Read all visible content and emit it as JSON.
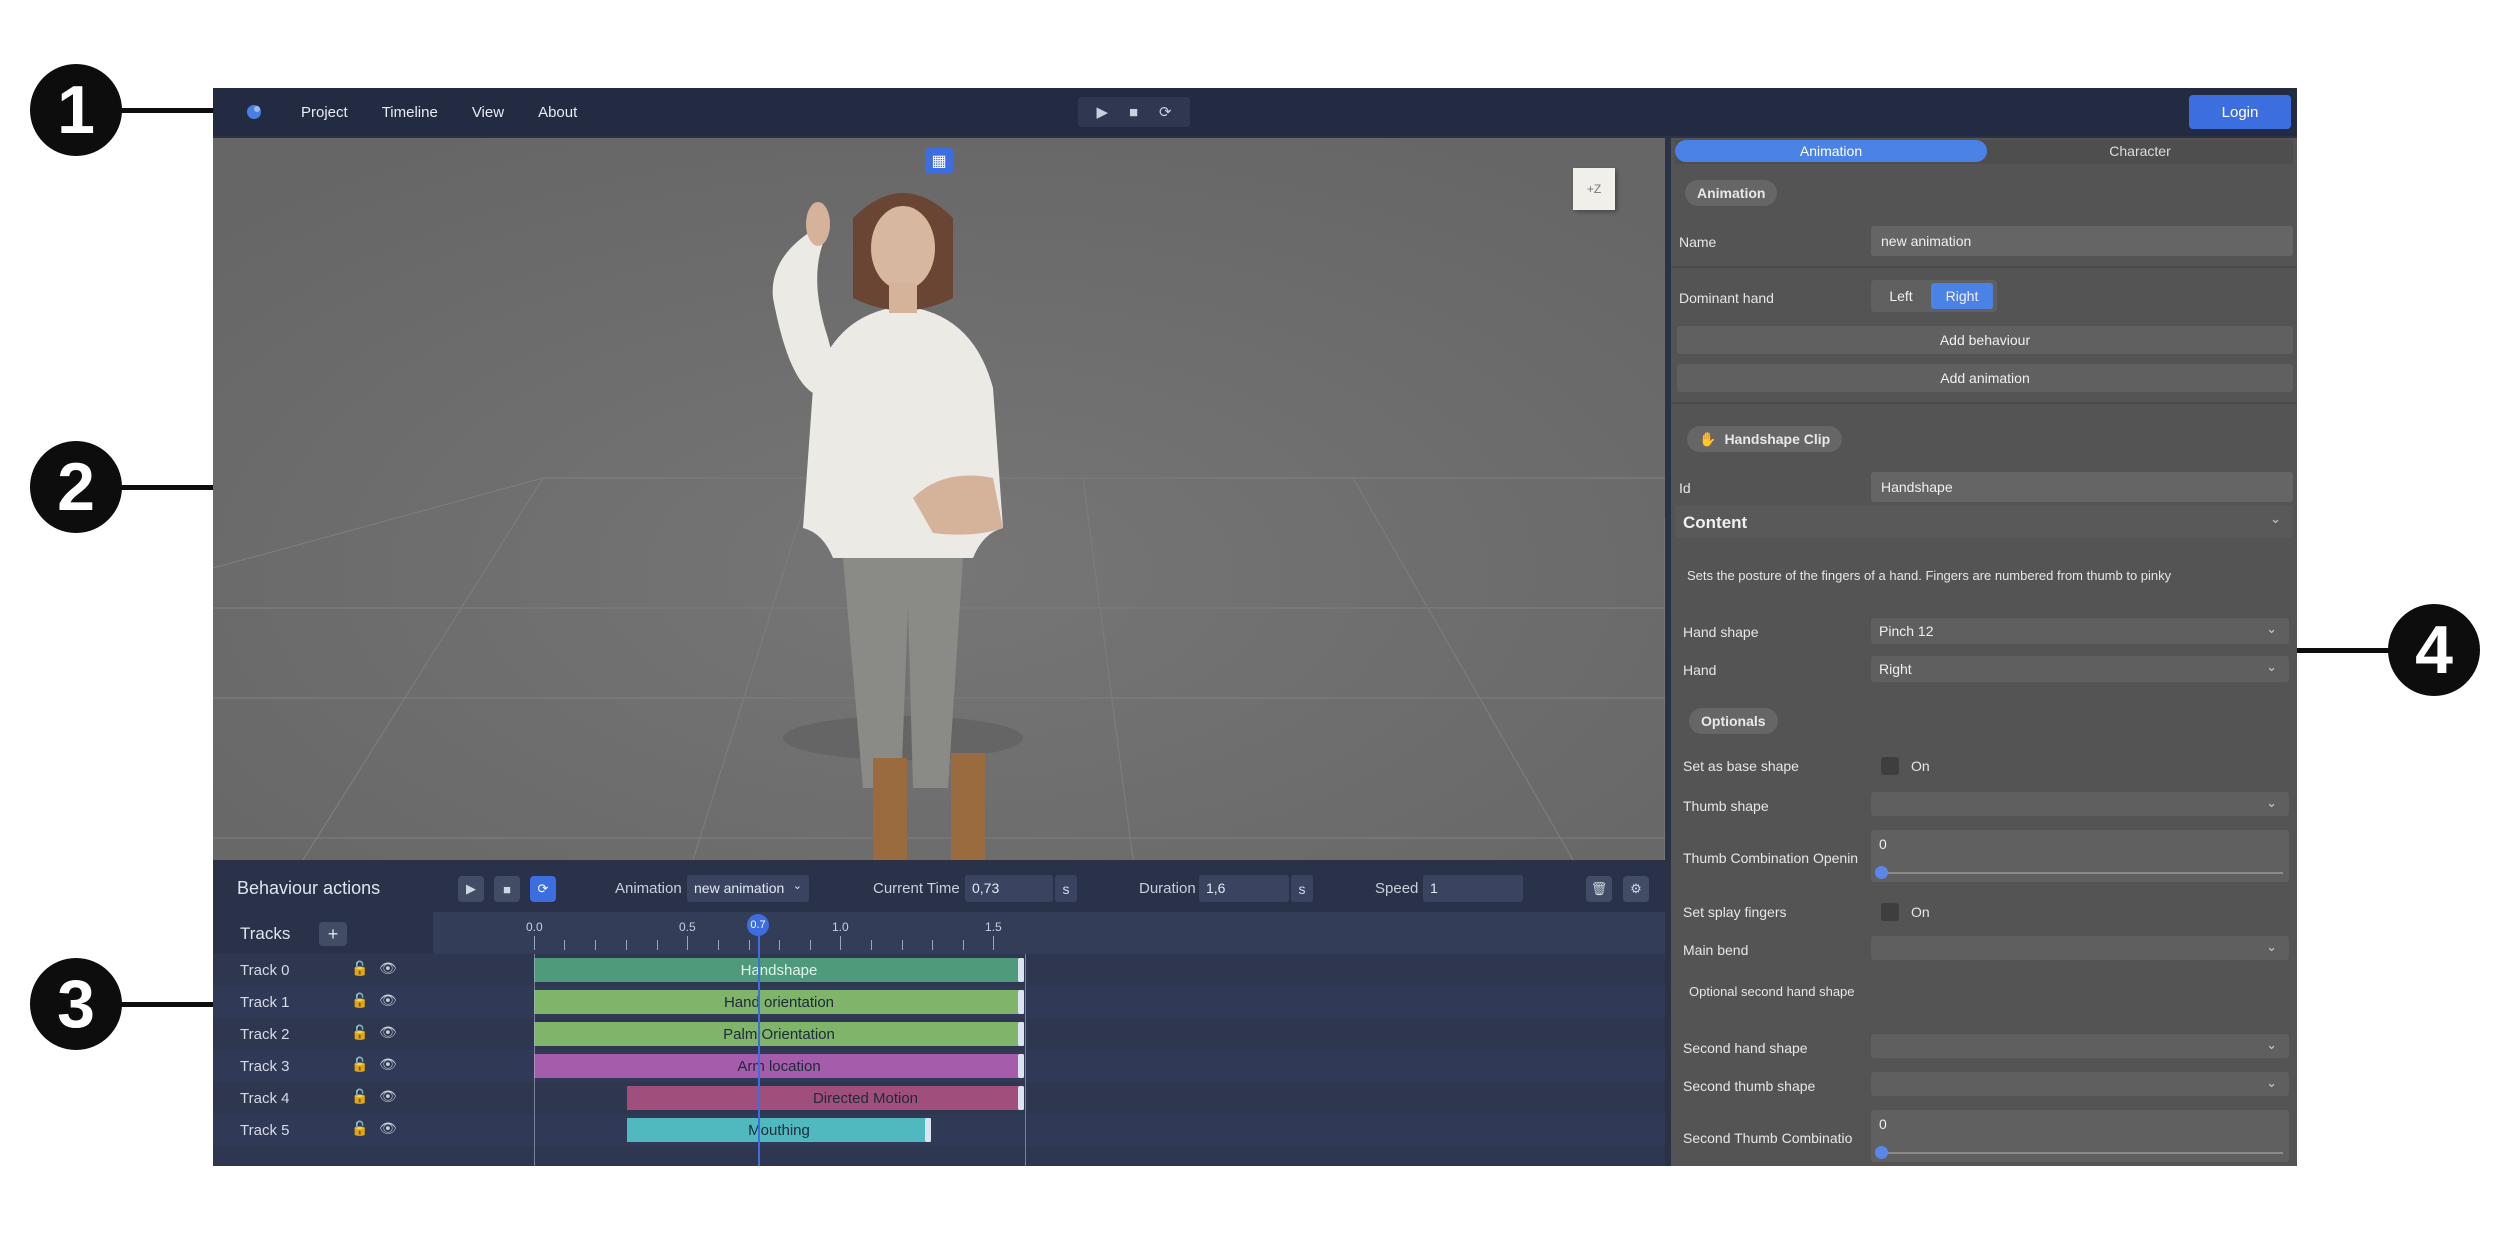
{
  "callouts": [
    "1",
    "2",
    "3",
    "4"
  ],
  "menu": {
    "items": [
      "Project",
      "Timeline",
      "View",
      "About"
    ],
    "login": "Login"
  },
  "viewport": {
    "axis_label": "+Z"
  },
  "behaviour": {
    "title": "Behaviour actions",
    "animation_label": "Animation",
    "animation_value": "new animation",
    "current_time_label": "Current Time",
    "current_time_value": "0,73",
    "duration_label": "Duration",
    "duration_value": "1,6",
    "speed_label": "Speed",
    "speed_value": "1",
    "unit": "s"
  },
  "timeline": {
    "tracks_label": "Tracks",
    "ruler_labels": [
      "0.0",
      "0.5",
      "0.7",
      "1.0",
      "1.5"
    ],
    "tracks": [
      {
        "name": "Track 0",
        "clip": "Handshape",
        "color": "#4e9a7a"
      },
      {
        "name": "Track 1",
        "clip": "Hand orientation",
        "color": "#7fb46a"
      },
      {
        "name": "Track 2",
        "clip": "Palm Orientation",
        "color": "#7fb46a"
      },
      {
        "name": "Track 3",
        "clip": "Arm location",
        "color": "#a45cab"
      },
      {
        "name": "Track 4",
        "clip": "Directed Motion",
        "color": "#a04f7c"
      },
      {
        "name": "Track 5",
        "clip": "Mouthing",
        "color": "#4fb9bf"
      }
    ]
  },
  "panel": {
    "tabs": [
      "Animation",
      "Character"
    ],
    "animation_section": "Animation",
    "name_label": "Name",
    "name_value": "new animation",
    "dominant_hand_label": "Dominant hand",
    "dominant_hand_options": [
      "Left",
      "Right"
    ],
    "add_behaviour": "Add behaviour",
    "add_animation": "Add animation",
    "clip_section": "Handshape Clip",
    "id_label": "Id",
    "id_value": "Handshape",
    "content_label": "Content",
    "content_desc": "Sets the posture of the fingers of a hand. Fingers are numbered from thumb to pinky",
    "hand_shape_label": "Hand shape",
    "hand_shape_value": "Pinch 12",
    "hand_label": "Hand",
    "hand_value": "Right",
    "optionals_label": "Optionals",
    "base_shape_label": "Set as base shape",
    "on_label": "On",
    "thumb_shape_label": "Thumb shape",
    "thumb_comb_label": "Thumb Combination Openin",
    "thumb_comb_value": "0",
    "splay_label": "Set splay fingers",
    "main_bend_label": "Main bend",
    "optional_second_label": "Optional second hand shape",
    "second_hand_shape_label": "Second hand shape",
    "second_thumb_shape_label": "Second thumb shape",
    "second_thumb_comb_label": "Second Thumb Combinatio",
    "second_thumb_comb_value": "0"
  }
}
